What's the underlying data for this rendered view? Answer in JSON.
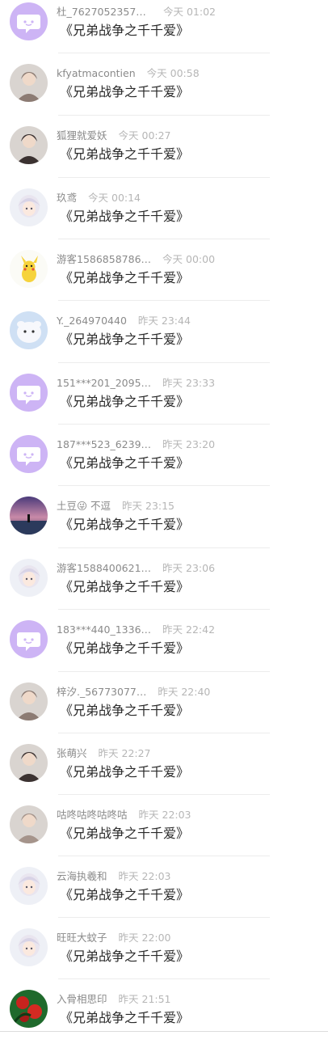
{
  "comments": [
    {
      "user": "杜_76270523579…",
      "time": "今天 01:02",
      "message": "《兄弟战争之千千爱》",
      "avatar": "default-bubble-icon"
    },
    {
      "user": "kfyatmacontien",
      "time": "今天 00:58",
      "message": "《兄弟战争之千千爱》",
      "avatar": "photo-avatar"
    },
    {
      "user": "狐狸就爱妖",
      "time": "今天 00:27",
      "message": "《兄弟战争之千千爱》",
      "avatar": "photo-avatar"
    },
    {
      "user": "玖鸢",
      "time": "今天 00:14",
      "message": "《兄弟战争之千千爱》",
      "avatar": "anime-avatar"
    },
    {
      "user": "游客1586858786…",
      "time": "今天 00:00",
      "message": "《兄弟战争之千千爱》",
      "avatar": "pikachu-avatar"
    },
    {
      "user": "Y._264970440",
      "time": "昨天 23:44",
      "message": "《兄弟战争之千千爱》",
      "avatar": "cartoon-avatar"
    },
    {
      "user": "151***201_2095…",
      "time": "昨天 23:33",
      "message": "《兄弟战争之千千爱》",
      "avatar": "default-bubble-icon"
    },
    {
      "user": "187***523_6239…",
      "time": "昨天 23:20",
      "message": "《兄弟战争之千千爱》",
      "avatar": "default-bubble-icon"
    },
    {
      "user": "土豆😜 不逗",
      "time": "昨天 23:15",
      "message": "《兄弟战争之千千爱》",
      "avatar": "sunset-avatar"
    },
    {
      "user": "游客1588400621…",
      "time": "昨天 23:06",
      "message": "《兄弟战争之千千爱》",
      "avatar": "anime-avatar"
    },
    {
      "user": "183***440_1336…",
      "time": "昨天 22:42",
      "message": "《兄弟战争之千千爱》",
      "avatar": "default-bubble-icon"
    },
    {
      "user": "梓汐._56773077…",
      "time": "昨天 22:40",
      "message": "《兄弟战争之千千爱》",
      "avatar": "photo-avatar"
    },
    {
      "user": "张萌兴",
      "time": "昨天 22:27",
      "message": "《兄弟战争之千千爱》",
      "avatar": "photo-avatar"
    },
    {
      "user": "咕咚咕咚咕咚咕",
      "time": "昨天 22:03",
      "message": "《兄弟战争之千千爱》",
      "avatar": "photo-avatar"
    },
    {
      "user": "云海执羲和",
      "time": "昨天 22:03",
      "message": "《兄弟战争之千千爱》",
      "avatar": "anime-avatar"
    },
    {
      "user": "旺旺大蚊子",
      "time": "昨天 22:00",
      "message": "《兄弟战争之千千爱》",
      "avatar": "anime-avatar"
    },
    {
      "user": "入骨相思印",
      "time": "昨天 21:51",
      "message": "《兄弟战争之千千爱》",
      "avatar": "flower-avatar"
    }
  ],
  "colors": {
    "default_avatar_bg": "#cdb4f5",
    "username": "#8a8a8a",
    "timestamp": "#b6b6b6",
    "message": "#2a2a2a",
    "divider": "#ececec"
  }
}
